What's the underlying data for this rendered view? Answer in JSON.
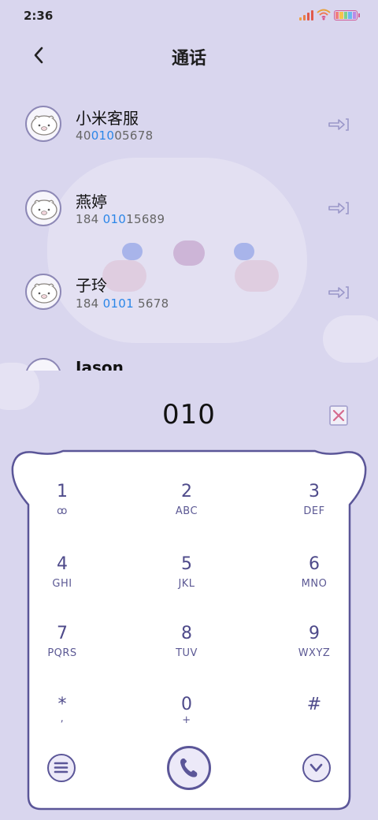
{
  "status": {
    "time": "2:36"
  },
  "header": {
    "title": "通话",
    "back_icon": "chevron-left-icon"
  },
  "contacts": [
    {
      "name": "小米客服",
      "number_parts": [
        "40",
        "010",
        "05678"
      ]
    },
    {
      "name": "燕婷",
      "number_parts": [
        "184 ",
        "010",
        "15689"
      ]
    },
    {
      "name": "子玲",
      "number_parts": [
        "184 ",
        "0101",
        " 5678"
      ]
    },
    {
      "name": "Jason",
      "number_parts": [
        "",
        "",
        ""
      ]
    }
  ],
  "dialer": {
    "input_value": "010",
    "keys": [
      {
        "digit": "1",
        "letters": "ꝏ"
      },
      {
        "digit": "2",
        "letters": "ABC"
      },
      {
        "digit": "3",
        "letters": "DEF"
      },
      {
        "digit": "4",
        "letters": "GHI"
      },
      {
        "digit": "5",
        "letters": "JKL"
      },
      {
        "digit": "6",
        "letters": "MNO"
      },
      {
        "digit": "7",
        "letters": "PQRS"
      },
      {
        "digit": "8",
        "letters": "TUV"
      },
      {
        "digit": "9",
        "letters": "WXYZ"
      },
      {
        "digit": "*",
        "letters": ","
      },
      {
        "digit": "0",
        "letters": "+"
      },
      {
        "digit": "#",
        "letters": ""
      }
    ]
  },
  "colors": {
    "accent": "#5b5698",
    "highlight": "#2b86e8",
    "background": "#d9d6ee"
  }
}
